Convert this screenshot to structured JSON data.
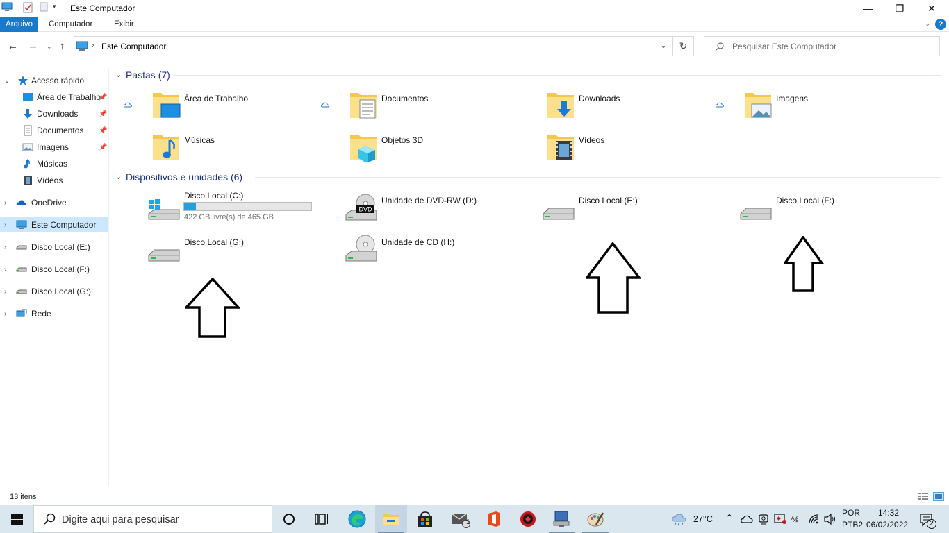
{
  "window": {
    "title": "Este Computador",
    "controls": {
      "minimize": "—",
      "maximize": "❐",
      "close": "✕"
    }
  },
  "ribbon": {
    "tabs": [
      {
        "label": "Arquivo",
        "active": true
      },
      {
        "label": "Computador",
        "active": false
      },
      {
        "label": "Exibir",
        "active": false
      }
    ],
    "help": "?"
  },
  "navigation": {
    "address_path": "Este Computador",
    "search_placeholder": "Pesquisar Este Computador"
  },
  "sidebar": {
    "items": [
      {
        "label": "Acesso rápido",
        "icon": "star-icon",
        "expanded": true,
        "indent": 0
      },
      {
        "label": "Área de Trabalho",
        "icon": "desktop-folder-icon",
        "pinned": true,
        "indent": 1
      },
      {
        "label": "Downloads",
        "icon": "download-arrow-icon",
        "pinned": true,
        "indent": 1
      },
      {
        "label": "Documentos",
        "icon": "document-icon",
        "pinned": true,
        "indent": 1
      },
      {
        "label": "Imagens",
        "icon": "image-icon",
        "pinned": true,
        "indent": 1
      },
      {
        "label": "Músicas",
        "icon": "music-note-icon",
        "pinned": false,
        "indent": 1
      },
      {
        "label": "Vídeos",
        "icon": "film-icon",
        "pinned": false,
        "indent": 1
      },
      {
        "label": "OneDrive",
        "icon": "cloud-icon",
        "indent": 0
      },
      {
        "label": "Este Computador",
        "icon": "computer-icon",
        "selected": true,
        "indent": 0
      },
      {
        "label": "Disco Local (E:)",
        "icon": "drive-icon",
        "indent": 0
      },
      {
        "label": "Disco Local (F:)",
        "icon": "drive-icon",
        "indent": 0
      },
      {
        "label": "Disco Local (G:)",
        "icon": "drive-icon",
        "indent": 0
      },
      {
        "label": "Rede",
        "icon": "network-icon",
        "indent": 0
      }
    ]
  },
  "main": {
    "folders_section": {
      "title": "Pastas (7)",
      "folders": [
        {
          "label": "Área de Trabalho",
          "icon": "desktop-folder-icon",
          "synced": true
        },
        {
          "label": "Documentos",
          "icon": "documents-folder-icon",
          "synced": true
        },
        {
          "label": "Downloads",
          "icon": "downloads-folder-icon",
          "synced": false
        },
        {
          "label": "Imagens",
          "icon": "pictures-folder-icon",
          "synced": true
        },
        {
          "label": "Músicas",
          "icon": "music-folder-icon",
          "synced": false
        },
        {
          "label": "Objetos 3D",
          "icon": "3d-objects-folder-icon",
          "synced": false
        },
        {
          "label": "Vídeos",
          "icon": "videos-folder-icon",
          "synced": false
        }
      ]
    },
    "devices_section": {
      "title": "Dispositivos e unidades (6)",
      "devices": [
        {
          "label": "Disco Local (C:)",
          "icon": "windows-drive-icon",
          "free_text": "422 GB livre(s) de 465 GB",
          "used_fraction": 0.092
        },
        {
          "label": "Unidade de DVD-RW (D:)",
          "icon": "dvd-drive-icon",
          "badge": "DVD"
        },
        {
          "label": "Disco Local (E:)",
          "icon": "drive-icon"
        },
        {
          "label": "Disco Local (F:)",
          "icon": "drive-icon"
        },
        {
          "label": "Disco Local (G:)",
          "icon": "drive-icon"
        },
        {
          "label": "Unidade de CD (H:)",
          "icon": "cd-drive-icon"
        }
      ]
    },
    "annotations": [
      {
        "type": "up-arrow",
        "points_to": "Disco Local (G:)"
      },
      {
        "type": "up-arrow",
        "points_to": "Disco Local (E:)"
      },
      {
        "type": "up-arrow",
        "points_to": "Disco Local (F:)"
      }
    ]
  },
  "statusbar": {
    "item_count": "13 itens"
  },
  "taskbar": {
    "search_placeholder": "Digite aqui para pesquisar",
    "apps": [
      "start-icon",
      "cortana-icon",
      "task-view-icon",
      "edge-icon",
      "file-explorer-icon",
      "store-icon",
      "mail-icon",
      "office-icon",
      "antivirus-icon",
      "network-app-icon",
      "paint-icon"
    ],
    "mail_badge": "1",
    "weather": "27°C",
    "language": {
      "line1": "POR",
      "line2": "PTB2"
    },
    "clock": {
      "time": "14:32",
      "date": "06/02/2022"
    },
    "notification_count": "2"
  },
  "colors": {
    "accent": "#1979ca",
    "selection": "#cce8ff",
    "section_heading": "#1e3287",
    "taskbar": "#dae7ef"
  }
}
